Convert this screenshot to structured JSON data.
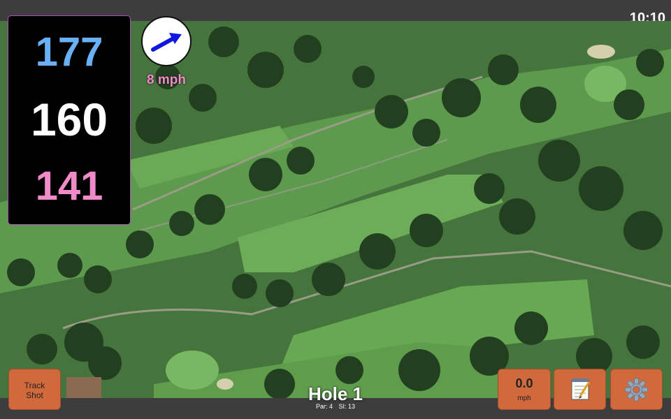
{
  "status": {
    "time": "10:10"
  },
  "distances": {
    "back": "177",
    "middle": "160",
    "front": "141"
  },
  "wind": {
    "speed": "8 mph",
    "direction_icon": "wind-arrow-icon"
  },
  "hole": {
    "title": "Hole 1",
    "par": "Par: 4",
    "stroke_index": "SI: 13"
  },
  "buttons": {
    "track_shot": "Track Shot",
    "speed_value": "0.0",
    "speed_unit": "mph",
    "notes_icon": "notepad-icon",
    "settings_icon": "gear-icon"
  },
  "colors": {
    "back_distance": "#6ab0f5",
    "middle_distance": "#ffffff",
    "front_distance": "#f08ac8",
    "button_bg": "#d06a3c",
    "accent": "#b04bc0"
  }
}
